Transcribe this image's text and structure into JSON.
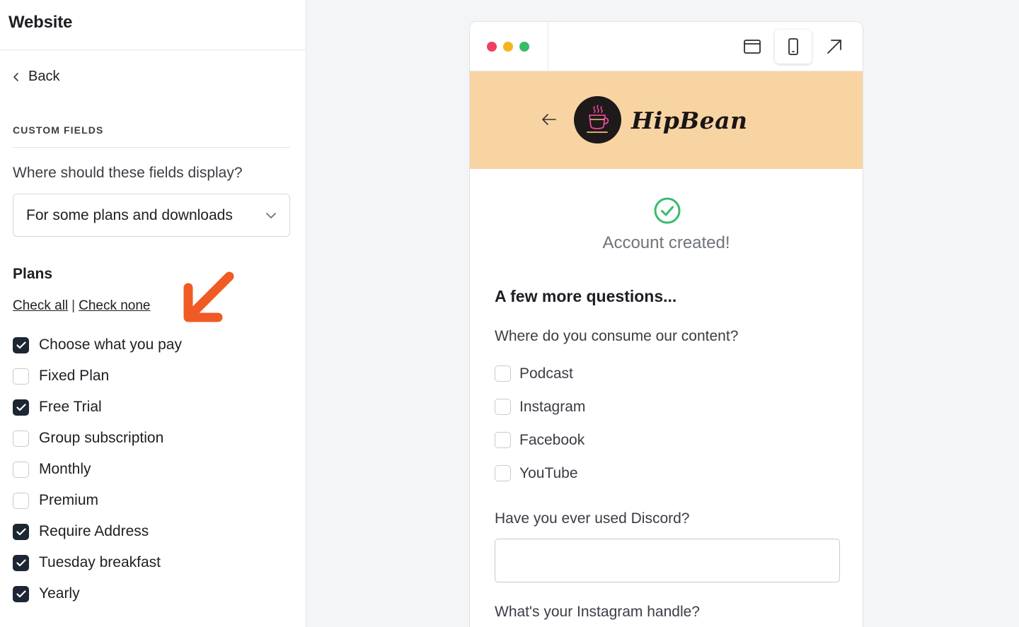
{
  "sidebar": {
    "title": "Website",
    "back_label": "Back",
    "section_label": "CUSTOM FIELDS",
    "display_question": "Where should these fields display?",
    "display_select": "For some plans and downloads",
    "plans_title": "Plans",
    "check_all": "Check all",
    "separator": "|",
    "check_none": "Check none",
    "plans": [
      {
        "label": "Choose what you pay",
        "checked": true
      },
      {
        "label": "Fixed Plan",
        "checked": false
      },
      {
        "label": "Free Trial",
        "checked": true
      },
      {
        "label": "Group subscription",
        "checked": false
      },
      {
        "label": "Monthly",
        "checked": false
      },
      {
        "label": "Premium",
        "checked": false
      },
      {
        "label": "Require Address",
        "checked": true
      },
      {
        "label": "Tuesday breakfast",
        "checked": true
      },
      {
        "label": "Yearly",
        "checked": true
      }
    ]
  },
  "annotation": {
    "arrow_color": "#f05a24"
  },
  "preview": {
    "window_dots": [
      "#ef4061",
      "#f5b31e",
      "#37bc6a"
    ],
    "toolbar": {
      "desktop_icon": "browser-window-icon",
      "mobile_icon": "mobile-phone-icon",
      "open_icon": "external-arrow-icon",
      "active": "mobile"
    },
    "banner_color": "#f8d4a3",
    "brand": "HipBean",
    "success_text": "Account created!",
    "success_color": "#37bc6a",
    "heading": "A few more questions...",
    "consume_question": "Where do you consume our content?",
    "consume_options": [
      {
        "label": "Podcast",
        "checked": false
      },
      {
        "label": "Instagram",
        "checked": false
      },
      {
        "label": "Facebook",
        "checked": false
      },
      {
        "label": "YouTube",
        "checked": false
      }
    ],
    "discord_question": "Have you ever used Discord?",
    "discord_value": "",
    "instagram_question": "What's your Instagram handle?"
  }
}
